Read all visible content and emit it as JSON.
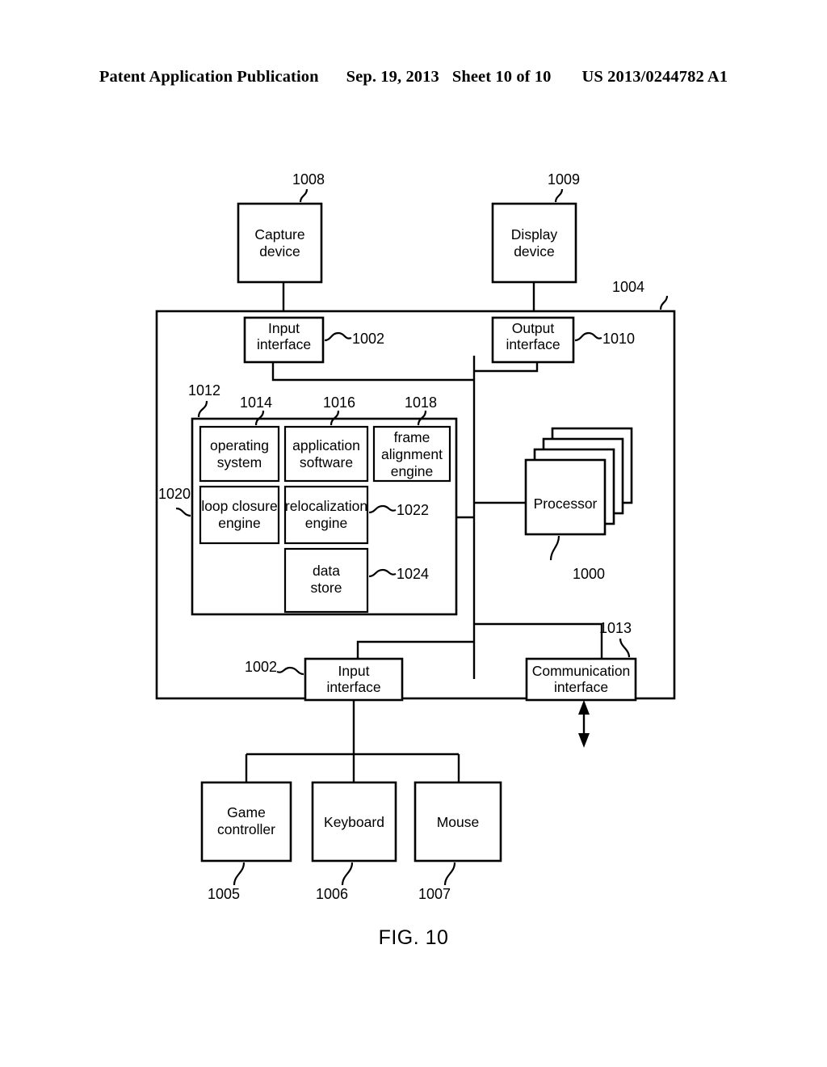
{
  "header": {
    "publication": "Patent Application Publication",
    "date": "Sep. 19, 2013",
    "sheet": "Sheet 10 of 10",
    "docnumber": "US 2013/0244782 A1"
  },
  "figure": {
    "caption": "FIG. 10",
    "blocks": {
      "capture_device": {
        "line1": "Capture",
        "line2": "device",
        "ref": "1008"
      },
      "display_device": {
        "line1": "Display",
        "line2": "device",
        "ref": "1009"
      },
      "input_interface_top": {
        "line1": "Input",
        "line2": "interface",
        "ref": "1002"
      },
      "output_interface": {
        "line1": "Output",
        "line2": "interface",
        "ref": "1010"
      },
      "computing_device": {
        "ref": "1004"
      },
      "memory": {
        "ref": "1012"
      },
      "operating_system": {
        "line1": "operating",
        "line2": "system",
        "ref": "1014"
      },
      "application_software": {
        "line1": "application",
        "line2": "software",
        "ref": "1016"
      },
      "frame_alignment_engine": {
        "line1": "frame",
        "line2": "alignment",
        "line3": "engine",
        "ref": "1018"
      },
      "loop_closure_engine": {
        "line1": "loop closure",
        "line2": "engine",
        "ref": "1020"
      },
      "relocalization_engine": {
        "line1": "relocalization",
        "line2": "engine",
        "ref": "1022"
      },
      "data_store": {
        "line1": "data",
        "line2": "store",
        "ref": "1024"
      },
      "processor": {
        "line1": "Processor",
        "ref": "1000"
      },
      "input_interface_bottom": {
        "line1": "Input",
        "line2": "interface",
        "ref": "1002"
      },
      "communication_interface": {
        "line1": "Communication",
        "line2": "interface",
        "ref": "1013"
      },
      "game_controller": {
        "line1": "Game",
        "line2": "controller",
        "ref": "1005"
      },
      "keyboard": {
        "line1": "Keyboard",
        "ref": "1006"
      },
      "mouse": {
        "line1": "Mouse",
        "ref": "1007"
      }
    }
  },
  "colors": {
    "ink": "#000000",
    "paper": "#ffffff"
  }
}
